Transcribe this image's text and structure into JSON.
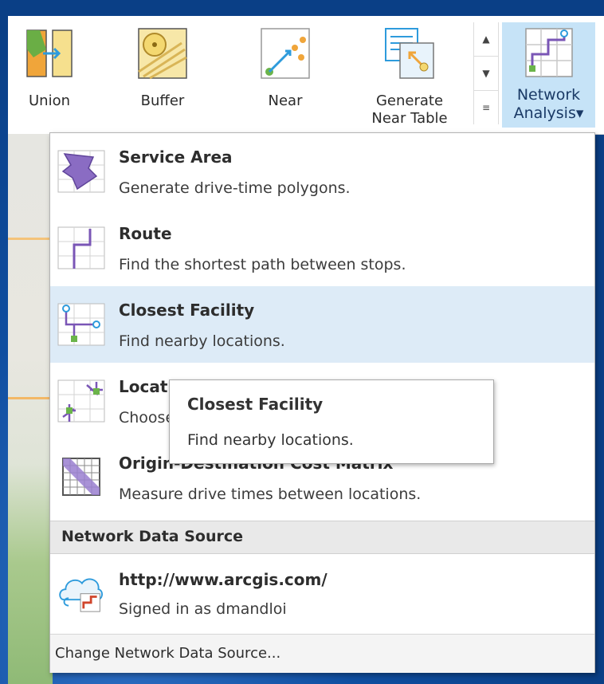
{
  "ribbon": {
    "buttons": [
      {
        "label": "Union",
        "icon": "union-icon"
      },
      {
        "label": "Buffer",
        "icon": "buffer-icon"
      },
      {
        "label": "Near",
        "icon": "near-icon"
      },
      {
        "label_line1": "Generate",
        "label_line2": "Near Table",
        "icon": "generate-near-table-icon"
      }
    ],
    "scroll_icons": [
      "scroll-up-icon",
      "scroll-down-icon",
      "expand-gallery-icon"
    ],
    "network_analysis": {
      "line1": "Network",
      "line2": "Analysis",
      "arrow": "▾",
      "icon": "network-analysis-icon"
    }
  },
  "menu": {
    "items": [
      {
        "title": "Service Area",
        "desc": "Generate drive-time polygons.",
        "icon": "service-area-icon"
      },
      {
        "title": "Route",
        "desc": "Find the shortest path between stops.",
        "icon": "route-icon"
      },
      {
        "title": "Closest Facility",
        "desc": "Find nearby locations.",
        "icon": "closest-facility-icon"
      },
      {
        "title": "Location-Allocation",
        "desc": "Choose the best locations for facilities.",
        "icon": "location-allocation-icon"
      },
      {
        "title": "Origin-Destination Cost Matrix",
        "desc": "Measure drive times between locations.",
        "icon": "od-cost-matrix-icon"
      }
    ],
    "section_header": "Network Data Source",
    "data_source": {
      "title": "http://www.arcgis.com/",
      "desc": "Signed in as dmandloi",
      "icon": "portal-network-icon"
    },
    "change_label": "Change Network Data Source..."
  },
  "tooltip": {
    "title": "Closest Facility",
    "desc": "Find nearby locations."
  },
  "colors": {
    "highlight": "#ddebf7",
    "active_button": "#c6e3f7",
    "accent": "#2e9bdc",
    "route_purple": "#7a56b6",
    "green_node": "#6bb44a"
  }
}
